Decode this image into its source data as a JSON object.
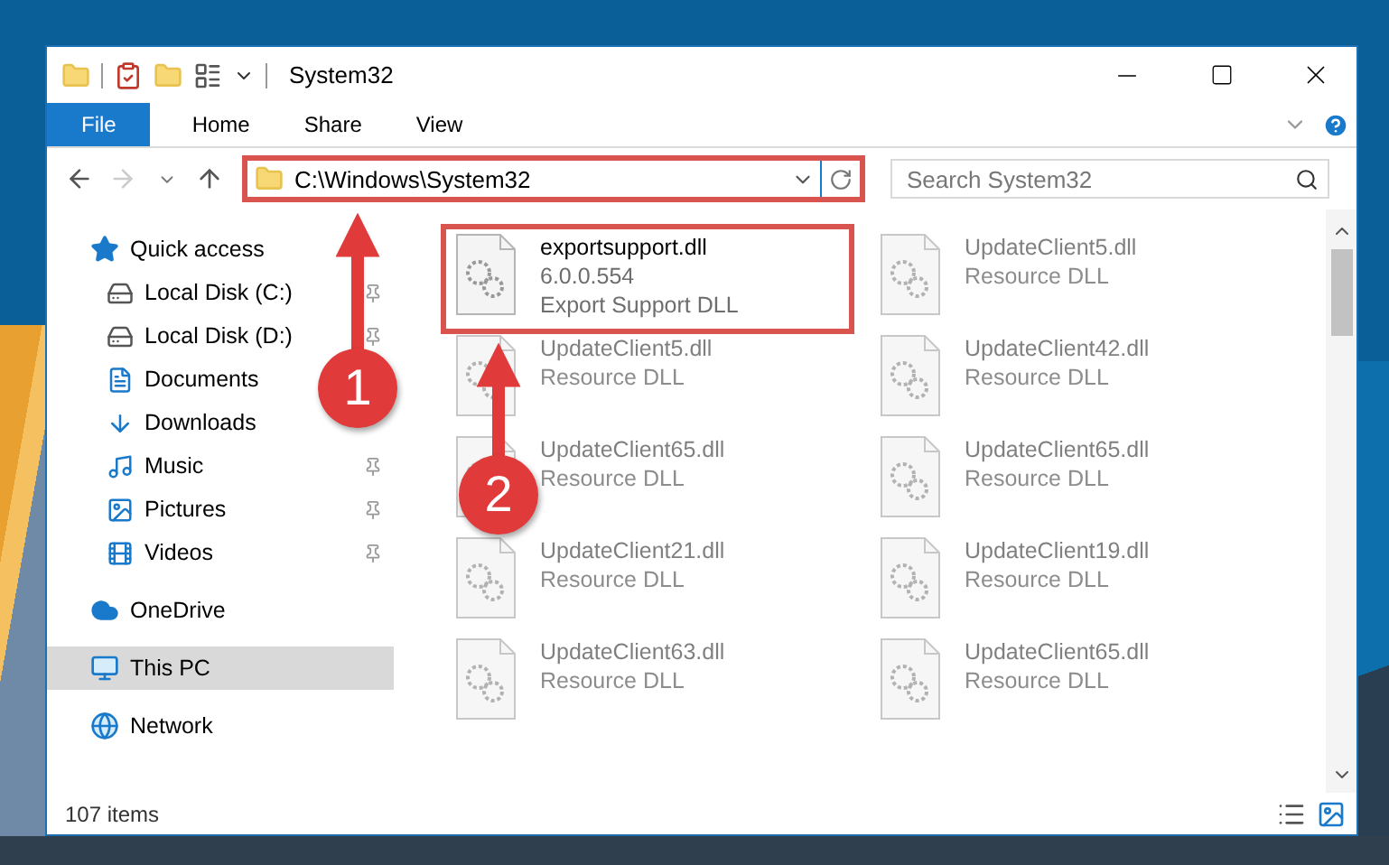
{
  "window": {
    "title": "System32"
  },
  "ribbon_tabs": [
    {
      "label": "File",
      "kind": "file"
    },
    {
      "label": "Home",
      "kind": "tab"
    },
    {
      "label": "Share",
      "kind": "tab"
    },
    {
      "label": "View",
      "kind": "tab"
    }
  ],
  "address_bar": {
    "path": "C:\\Windows\\System32",
    "highlighted": true
  },
  "search": {
    "placeholder": "Search System32"
  },
  "nav": [
    {
      "label": "Quick access",
      "selected": false,
      "children": [
        {
          "label": "Local Disk (C:)",
          "pinned": true,
          "selected": false
        },
        {
          "label": "Local Disk (D:)",
          "pinned": true,
          "selected": false
        },
        {
          "label": "Documents",
          "pinned": false,
          "selected": false
        },
        {
          "label": "Downloads",
          "pinned": false,
          "selected": false
        },
        {
          "label": "Music",
          "pinned": true,
          "selected": false
        },
        {
          "label": "Pictures",
          "pinned": true,
          "selected": false
        },
        {
          "label": "Videos",
          "pinned": true,
          "selected": false
        }
      ]
    },
    {
      "label": "OneDrive",
      "selected": false
    },
    {
      "label": "This PC",
      "selected": true
    },
    {
      "label": "Network",
      "selected": false
    }
  ],
  "files": [
    {
      "name": "exportsupport.dll",
      "lines": [
        "6.0.0.554",
        "Export Support DLL"
      ],
      "highlighted": true,
      "blurred": false
    },
    {
      "name": "UpdateClient5.dll",
      "lines": [
        "Resource DLL"
      ],
      "highlighted": false,
      "blurred": true
    },
    {
      "name": "UpdateClient5.dll",
      "lines": [
        "Resource DLL"
      ],
      "highlighted": false,
      "blurred": true
    },
    {
      "name": "UpdateClient42.dll",
      "lines": [
        "Resource DLL"
      ],
      "highlighted": false,
      "blurred": true
    },
    {
      "name": "UpdateClient65.dll",
      "lines": [
        "Resource DLL"
      ],
      "highlighted": false,
      "blurred": true
    },
    {
      "name": "UpdateClient65.dll",
      "lines": [
        "Resource DLL"
      ],
      "highlighted": false,
      "blurred": true
    },
    {
      "name": "UpdateClient21.dll",
      "lines": [
        "Resource DLL"
      ],
      "highlighted": false,
      "blurred": true
    },
    {
      "name": "UpdateClient19.dll",
      "lines": [
        "Resource DLL"
      ],
      "highlighted": false,
      "blurred": true
    },
    {
      "name": "UpdateClient63.dll",
      "lines": [
        "Resource DLL"
      ],
      "highlighted": false,
      "blurred": true
    },
    {
      "name": "UpdateClient65.dll",
      "lines": [
        "Resource DLL"
      ],
      "highlighted": false,
      "blurred": true
    }
  ],
  "status_bar": {
    "count": "107 items"
  },
  "annotations": [
    {
      "number": "1"
    },
    {
      "number": "2"
    }
  ]
}
